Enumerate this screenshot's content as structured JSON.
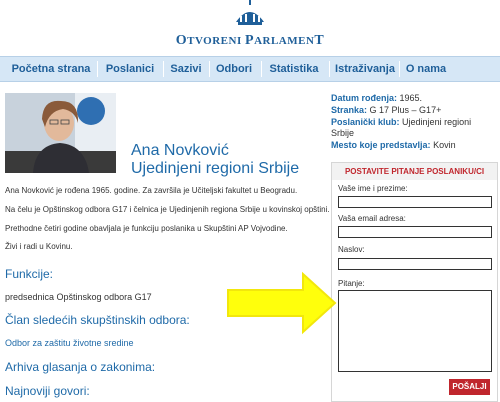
{
  "brand": {
    "prefix_big": "O",
    "prefix_small": "TVORENI ",
    "suffix_big": "P",
    "suffix_small": "ARLAMEN",
    "suffix_end": "T"
  },
  "nav": {
    "items": [
      "Početna strana",
      "Poslanici",
      "Sazivi",
      "Odbori",
      "Statistika",
      "Istraživanja",
      "O nama"
    ]
  },
  "profile": {
    "name_line1": "Ana Novković",
    "name_line2": "Ujedinjeni regioni Srbije",
    "bio": [
      "Ana Novković je rođena 1965. godine. Za završila je Učiteljski fakultet u Beogradu.",
      "Na čelu je Opštinskog odbora G17 i čelnica je Ujedinjenih regiona Srbije u kovinskoj opštini.",
      "Prethodne četiri godine obavljala je funkciju poslanika u Skupštini AP Vojvodine.",
      "Živi i radi u Kovinu."
    ]
  },
  "sections": {
    "funkcije_title": "Funkcije:",
    "funkcije_value": "predsednica Opštinskog odbora G17",
    "odbori_title": "Član sledećih skupštinskih odbora:",
    "odbori_link": "Odbor za zaštitu životne sredine",
    "arhiva_title": "Arhiva glasanja o zakonima:",
    "govori_title": "Najnoviji govori:"
  },
  "info": {
    "datum_label": "Datum rođenja:",
    "datum_value": "1965.",
    "stranka_label": "Stranka:",
    "stranka_value": "G 17 Plus – G17+",
    "klub_label": "Poslanički klub:",
    "klub_value": "Ujedinjeni regioni",
    "klub_value2": "Srbije",
    "mesto_label": "Mesto koje predstavlja:",
    "mesto_value": "Kovin"
  },
  "form": {
    "header": "POSTAVITE PITANJE POSLANIKU/CI",
    "name_label": "Vaše ime i prezime:",
    "email_label": "Vaša email adresa:",
    "subject_label": "Naslov:",
    "question_label": "Pitanje:",
    "submit_label": "POŠALJI"
  },
  "colors": {
    "brand_blue": "#1f5f99",
    "nav_bg": "#d6e7f6",
    "accent_red": "#c0262d",
    "annotation_arrow": "#ffff00"
  }
}
